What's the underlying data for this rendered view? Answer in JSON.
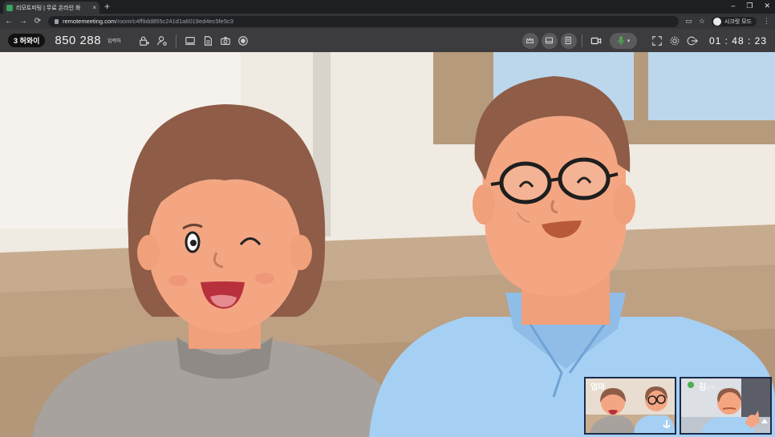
{
  "browser": {
    "tab_title": "리모트미팅 | 무료 온라인 화",
    "new_tab": "+",
    "url_host": "remotemeeting.com",
    "url_path": "/room/c4ff9dd855c241d1a6019ed4ec5fe5c3",
    "profile_label": "시크릿 모드",
    "window_controls": [
      "–",
      "❐",
      "✕"
    ]
  },
  "toolbar": {
    "participants_count": "3",
    "participants_label": "3 허와이",
    "room_code": "850 288",
    "room_code_label": "입력하",
    "timer": "01 : 48 : 23"
  },
  "thumbnails": [
    {
      "name": "엄마"
    },
    {
      "name": "김○○"
    }
  ],
  "colors": {
    "toolbar_bg": "#3c3c3e",
    "accent_green": "#4caf50",
    "thumb_border": "#1b2b4a"
  },
  "icons": [
    "lock-add-icon",
    "user-settings-icon",
    "screen-share-icon",
    "document-icon",
    "camera-icon",
    "record-icon",
    "crown-icon",
    "layout-icon",
    "notes-icon",
    "video-icon",
    "mic-icon",
    "fullscreen-icon",
    "settings-icon",
    "exit-icon",
    "arrow-down-icon"
  ]
}
